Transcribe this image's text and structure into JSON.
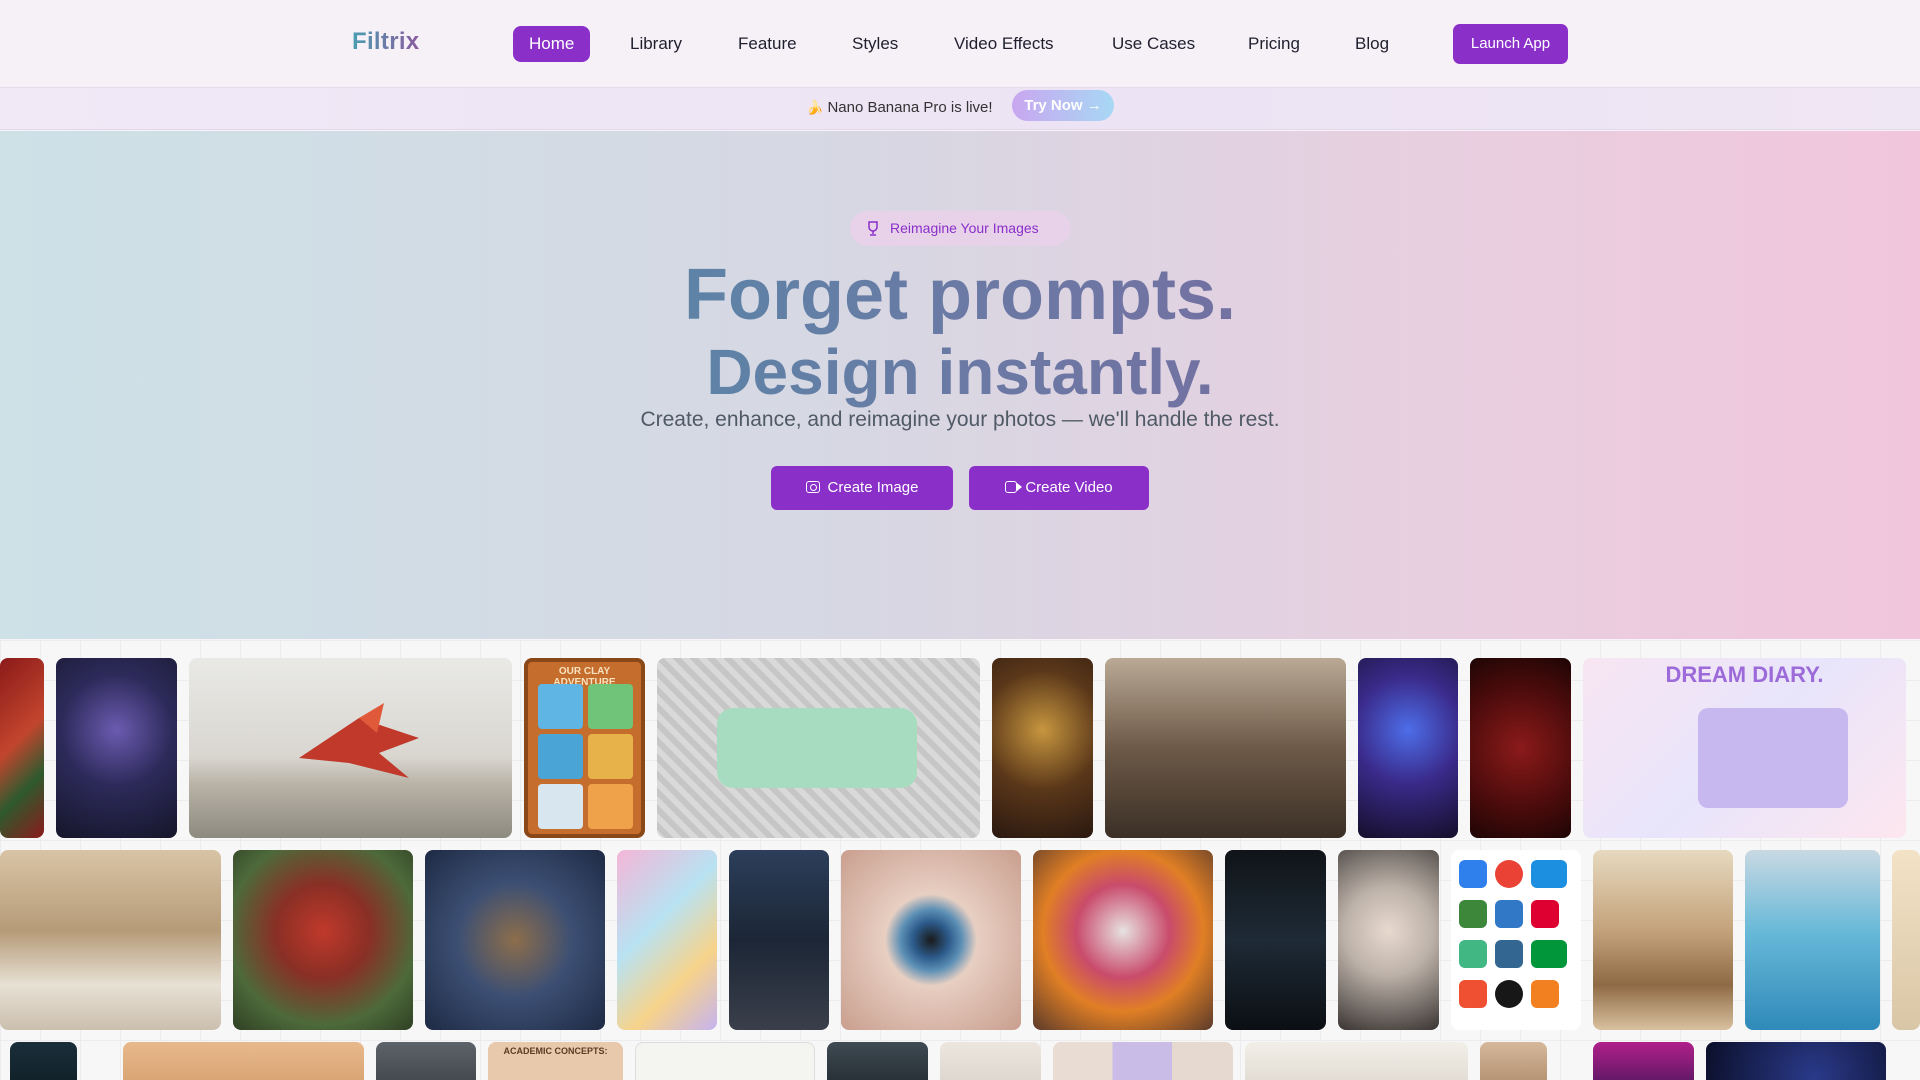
{
  "brand": {
    "name": "Filtrix"
  },
  "nav": {
    "items": [
      {
        "label": "Home",
        "active": true
      },
      {
        "label": "Library"
      },
      {
        "label": "Feature"
      },
      {
        "label": "Styles"
      },
      {
        "label": "Video Effects"
      },
      {
        "label": "Use Cases"
      },
      {
        "label": "Pricing"
      },
      {
        "label": "Blog"
      }
    ],
    "launch_label": "Launch App"
  },
  "announcement": {
    "icon": "banana-emoji",
    "text": "Nano Banana Pro is live!",
    "cta": "Try Now →"
  },
  "hero": {
    "pill": "Reimagine Your Images",
    "headline_1": "Forget prompts.",
    "headline_2": "Design instantly.",
    "subtitle": "Create, enhance, and reimagine your photos — we'll handle the rest.",
    "buttons": [
      {
        "label": "Create Image",
        "icon": "camera-icon"
      },
      {
        "label": "Create Video",
        "icon": "video-icon"
      }
    ]
  },
  "gallery": {
    "row1": [
      {
        "name": "red-forest-art"
      },
      {
        "name": "stained-glass-witch"
      },
      {
        "name": "origami-dragon"
      },
      {
        "name": "clay-adventure-comic",
        "caption": "OUR CLAY ADVENTURE"
      },
      {
        "name": "speech-bubble-table"
      },
      {
        "name": "angel-statue"
      },
      {
        "name": "kitchen-friends"
      },
      {
        "name": "neon-body-paint"
      },
      {
        "name": "wine-bottle"
      },
      {
        "name": "dream-diary",
        "caption": "DREAM DIARY."
      }
    ],
    "row2": [
      {
        "name": "living-room-interior"
      },
      {
        "name": "red-camera-diorama"
      },
      {
        "name": "tiny-planet"
      },
      {
        "name": "sticker-collage-girl"
      },
      {
        "name": "photo-booth-strip"
      },
      {
        "name": "eye-closeup"
      },
      {
        "name": "catrina-portrait"
      },
      {
        "name": "figure-display-case"
      },
      {
        "name": "platinum-portrait"
      },
      {
        "name": "tech-logo-stickers"
      },
      {
        "name": "dog-walker-paris"
      },
      {
        "name": "poolside-portrait"
      }
    ],
    "row3": [
      {
        "name": "row3-tile-1"
      },
      {
        "name": "row3-tile-2"
      },
      {
        "name": "row3-tile-3"
      },
      {
        "name": "academic-concepts",
        "caption": "ACADEMIC CONCEPTS:"
      },
      {
        "name": "floor-plan"
      },
      {
        "name": "row3-tile-6"
      },
      {
        "name": "row3-tile-7"
      },
      {
        "name": "expression-grid"
      },
      {
        "name": "row3-tile-9"
      },
      {
        "name": "row3-tile-10"
      },
      {
        "name": "neon-street"
      },
      {
        "name": "night-sky"
      }
    ]
  }
}
